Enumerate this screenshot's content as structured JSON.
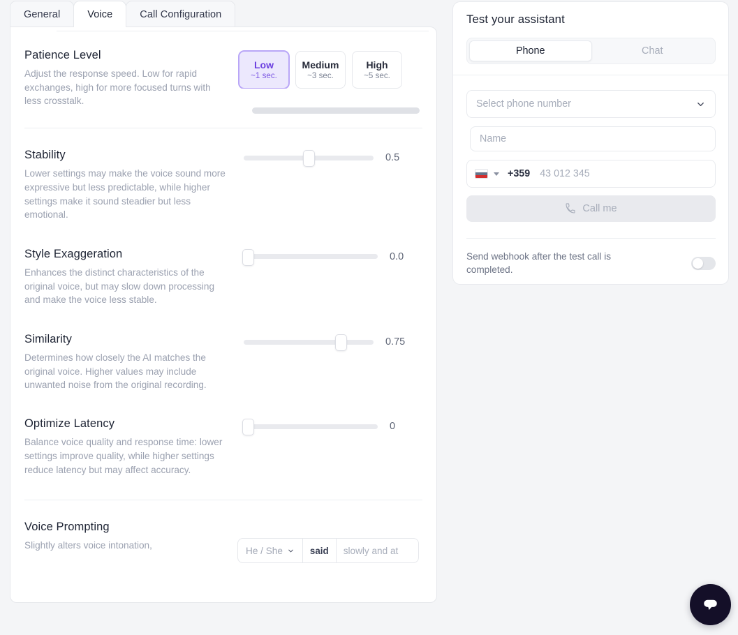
{
  "tabs": [
    {
      "label": "General",
      "active": false
    },
    {
      "label": "Voice",
      "active": true
    },
    {
      "label": "Call Configuration",
      "active": false
    }
  ],
  "settings": {
    "patience": {
      "title": "Patience Level",
      "description": "Adjust the response speed. Low for rapid exchanges, high for more focused turns with less crosstalk.",
      "options": [
        {
          "label": "Low",
          "sub": "~1 sec.",
          "selected": true
        },
        {
          "label": "Medium",
          "sub": "~3 sec.",
          "selected": false
        },
        {
          "label": "High",
          "sub": "~5 sec.",
          "selected": false
        }
      ]
    },
    "stability": {
      "title": "Stability",
      "description": "Lower settings may make the voice sound more expressive but less predictable, while higher settings make it sound steadier but less emotional.",
      "value": "0.5"
    },
    "style_exaggeration": {
      "title": "Style Exaggeration",
      "description": "Enhances the distinct characteristics of the original voice, but may slow down processing and make the voice less stable.",
      "value": "0.0"
    },
    "similarity": {
      "title": "Similarity",
      "description": "Determines how closely the AI matches the original voice. Higher values may include unwanted noise from the original recording.",
      "value": "0.75"
    },
    "optimize_latency": {
      "title": "Optimize Latency",
      "description": "Balance voice quality and response time: lower settings improve quality, while higher settings reduce latency but may affect accuracy.",
      "value": "0"
    },
    "voice_prompting": {
      "title": "Voice Prompting",
      "description": "Slightly alters voice intonation,",
      "subject": "He / She",
      "verb": "said",
      "manner_placeholder": "slowly and at"
    }
  },
  "test_panel": {
    "title": "Test your assistant",
    "modes": [
      {
        "label": "Phone",
        "active": true
      },
      {
        "label": "Chat",
        "active": false
      }
    ],
    "phone_select_placeholder": "Select phone number",
    "name_placeholder": "Name",
    "dial_code": "+359",
    "phone_placeholder": "43 012 345",
    "call_button": "Call me",
    "webhook_label": "Send webhook after the test call is completed.",
    "webhook_enabled": false
  },
  "chat_fab": {
    "icon": "chat-bubble-icon"
  }
}
